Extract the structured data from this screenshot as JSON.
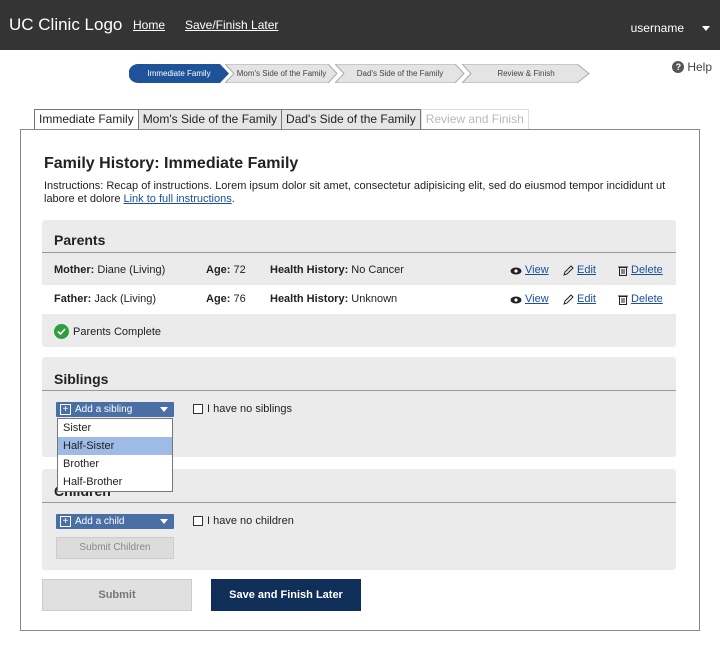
{
  "topbar": {
    "logo": "UC Clinic Logo",
    "home": "Home",
    "save_finish": "Save/Finish Later",
    "username": "username"
  },
  "steps": [
    "Immediate Family",
    "Mom's Side of the Family",
    "Dad's Side of the Family",
    "Review & Finish"
  ],
  "help": "Help",
  "tabs": [
    "Immediate Family",
    "Mom's Side of the Family",
    "Dad's Side of the Family",
    "Review and Finish"
  ],
  "page": {
    "title": "Family History: Immediate Family",
    "instructions": "Instructions:  Recap of instructions. Lorem ipsum dolor sit amet, consectetur adipisicing elit, sed do eiusmod tempor incididunt ut labore et dolore ",
    "instructions_link": "Link to full instructions",
    "instructions_end": "."
  },
  "parents": {
    "title": "Parents",
    "rows": [
      {
        "rel": "Mother:",
        "name": " Diane (Living)",
        "age_label": "Age:",
        "age": " 72",
        "hh_label": "Health History:",
        "hh": " No Cancer"
      },
      {
        "rel": "Father:",
        "name": " Jack (Living)",
        "age_label": "Age:",
        "age": " 76",
        "hh_label": "Health History:",
        "hh": " Unknown"
      }
    ],
    "actions": {
      "view": "View",
      "edit": "Edit",
      "delete": "Delete"
    },
    "complete": "Parents Complete"
  },
  "siblings": {
    "title": "Siblings",
    "add": "Add a sibling",
    "none": "I have no siblings",
    "menu": [
      "Sister",
      "Half-Sister",
      "Brother",
      "Half-Brother"
    ],
    "highlighted": "Half-Sister"
  },
  "children": {
    "title": "Children",
    "add": "Add a child",
    "none": "I have no children",
    "submit": "Submit Children"
  },
  "buttons": {
    "submit": "Submit",
    "save": "Save and Finish Later"
  },
  "colors": {
    "topbar": "#343434",
    "step_active": "#1f5399",
    "dropdown": "#4a6fa5",
    "primary": "#102f58",
    "check": "#2e9e3f"
  }
}
